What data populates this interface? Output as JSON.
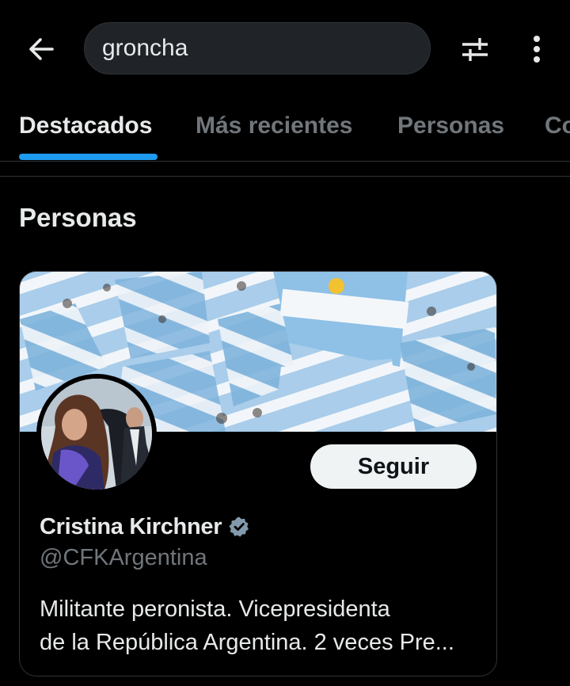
{
  "search": {
    "query": "groncha"
  },
  "icons": {
    "back": "arrow-left-icon",
    "filter": "sliders-icon",
    "more": "vertical-ellipsis-icon",
    "verified": "verified-badge-icon"
  },
  "tabs": [
    {
      "label": "Destacados",
      "active": true
    },
    {
      "label": "Más recientes",
      "active": false
    },
    {
      "label": "Personas",
      "active": false
    },
    {
      "label": "Co",
      "active": false
    }
  ],
  "section": {
    "title": "Personas"
  },
  "person": {
    "name": "Cristina Kirchner",
    "handle": "@CFKArgentina",
    "bio_line1": "Militante peronista. Vicepresidenta",
    "bio_line2": "de la República Argentina. 2 veces Pre...",
    "follow_label": "Seguir",
    "verified_color": "#829aab"
  },
  "colors": {
    "background": "#000000",
    "accent": "#1d9bf0",
    "text_primary": "#e7e9ea",
    "text_secondary": "#71767b",
    "button_bg": "#eff3f4"
  }
}
